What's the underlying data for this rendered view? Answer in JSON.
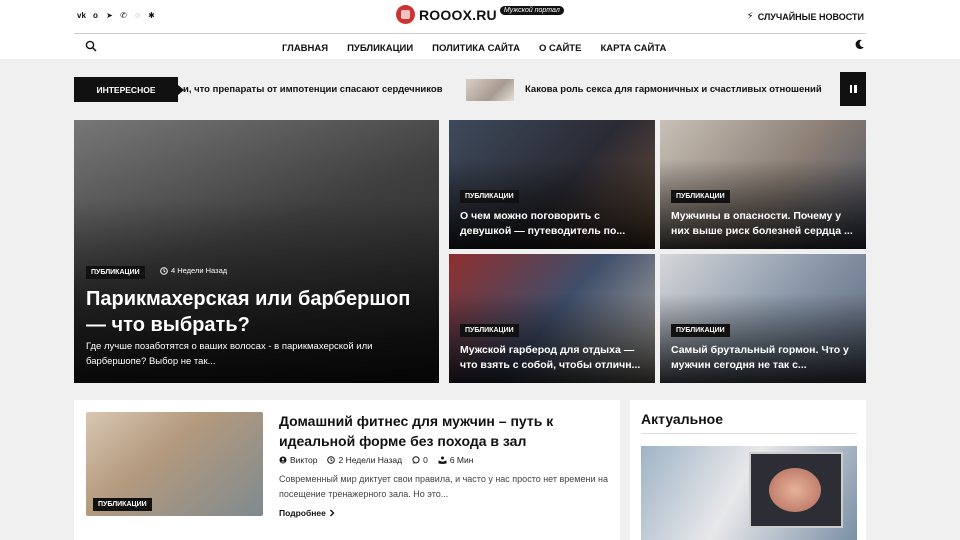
{
  "header": {
    "social_icons": [
      "vk-icon",
      "odnoklassniki-icon",
      "telegram-icon",
      "viber-icon",
      "whatsapp-icon",
      "yandex-zen-icon"
    ],
    "logo_text": "ROOOX.RU",
    "logo_badge": "Мужской портал",
    "random_news": "СЛУЧАЙНЫЕ НОВОСТИ"
  },
  "nav": {
    "items": [
      "ГЛАВНАЯ",
      "ПУБЛИКАЦИИ",
      "ПОЛИТИКА САЙТА",
      "О САЙТЕ",
      "КАРТА САЙТА"
    ]
  },
  "ticker": {
    "label": "ИНТЕРЕСНОЕ",
    "item1": "и, что препараты от импотенции спасают сердечников",
    "item2": "Какова роль секса для гармоничных и счастливых отношений"
  },
  "featured": {
    "badge": "ПУБЛИКАЦИИ",
    "time": "4 Недели Назад",
    "title": "Парикмахерская или барбершоп — что выбрать?",
    "excerpt": " Где лучше позаботятся о ваших волосах - в парикмахерской или барбершопе? Выбор не так..."
  },
  "cards": [
    {
      "badge": "ПУБЛИКАЦИИ",
      "title": "О чем можно поговорить с девушкой — путеводитель по..."
    },
    {
      "badge": "ПУБЛИКАЦИИ",
      "title": "Мужчины в опасности. Почему у них выше риск болезней сердца ..."
    },
    {
      "badge": "ПУБЛИКАЦИИ",
      "title": "Мужской гарберод для отдыха — что взять с собой, чтобы отличн..."
    },
    {
      "badge": "ПУБЛИКАЦИИ",
      "title": "Самый брутальный гормон. Что у мужчин сегодня не так с..."
    }
  ],
  "post": {
    "badge": "ПУБЛИКАЦИИ",
    "title": "Домашний фитнес для мужчин – путь к идеальной форме без похода в зал",
    "author": "Виктор",
    "date": "2 Недели Назад",
    "comments": "0",
    "read_time": "6 Мин",
    "excerpt": "Современный мир диктует свои правила, и часто у нас просто нет времени на посещение тренажерного зала. Но это...",
    "more": "Подробнее"
  },
  "sidebar": {
    "title": "Актуальное"
  },
  "colors": {
    "dark": "#111111",
    "background": "#f0f0f0"
  }
}
